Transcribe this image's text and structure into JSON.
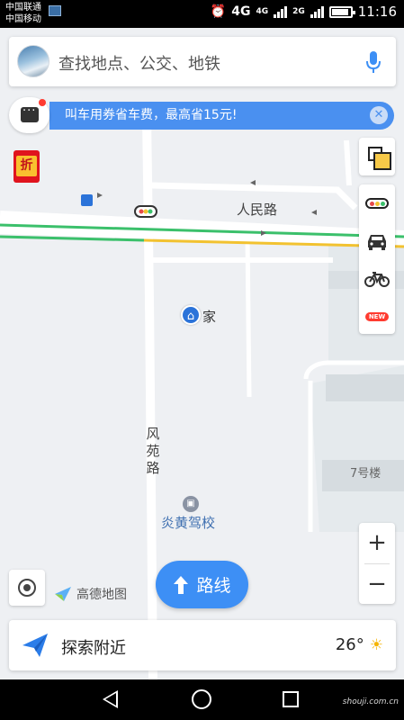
{
  "status_bar": {
    "carrier_1": "中国联通",
    "carrier_2": "中国移动",
    "network_1": "4G",
    "network_2": "4G",
    "network_3": "2G",
    "time": "11:16"
  },
  "search": {
    "placeholder": "查找地点、公交、地铁"
  },
  "promo": {
    "text": "叫车用券省车费，最高省15元!",
    "close": "✕"
  },
  "hongbao": {
    "label": "折"
  },
  "tools": {
    "new_badge": "NEW"
  },
  "map": {
    "road_horizontal": "人民路",
    "road_vertical": [
      "风",
      "苑",
      "路"
    ],
    "home_label": "家",
    "school_label": "炎黄驾校",
    "building_label": "7号楼",
    "logo_text": "高德地图"
  },
  "zoom": {
    "in": "+",
    "out": "−"
  },
  "route_button": {
    "label": "路线"
  },
  "nearby": {
    "label": "探索附近",
    "temperature": "26°"
  },
  "navbar": {
    "watermark": "shouji.com.cn"
  },
  "colors": {
    "accent": "#3d8ff5",
    "promo": "#4a90f0",
    "road_green": "#3bc06b",
    "road_yellow": "#f2c230"
  }
}
